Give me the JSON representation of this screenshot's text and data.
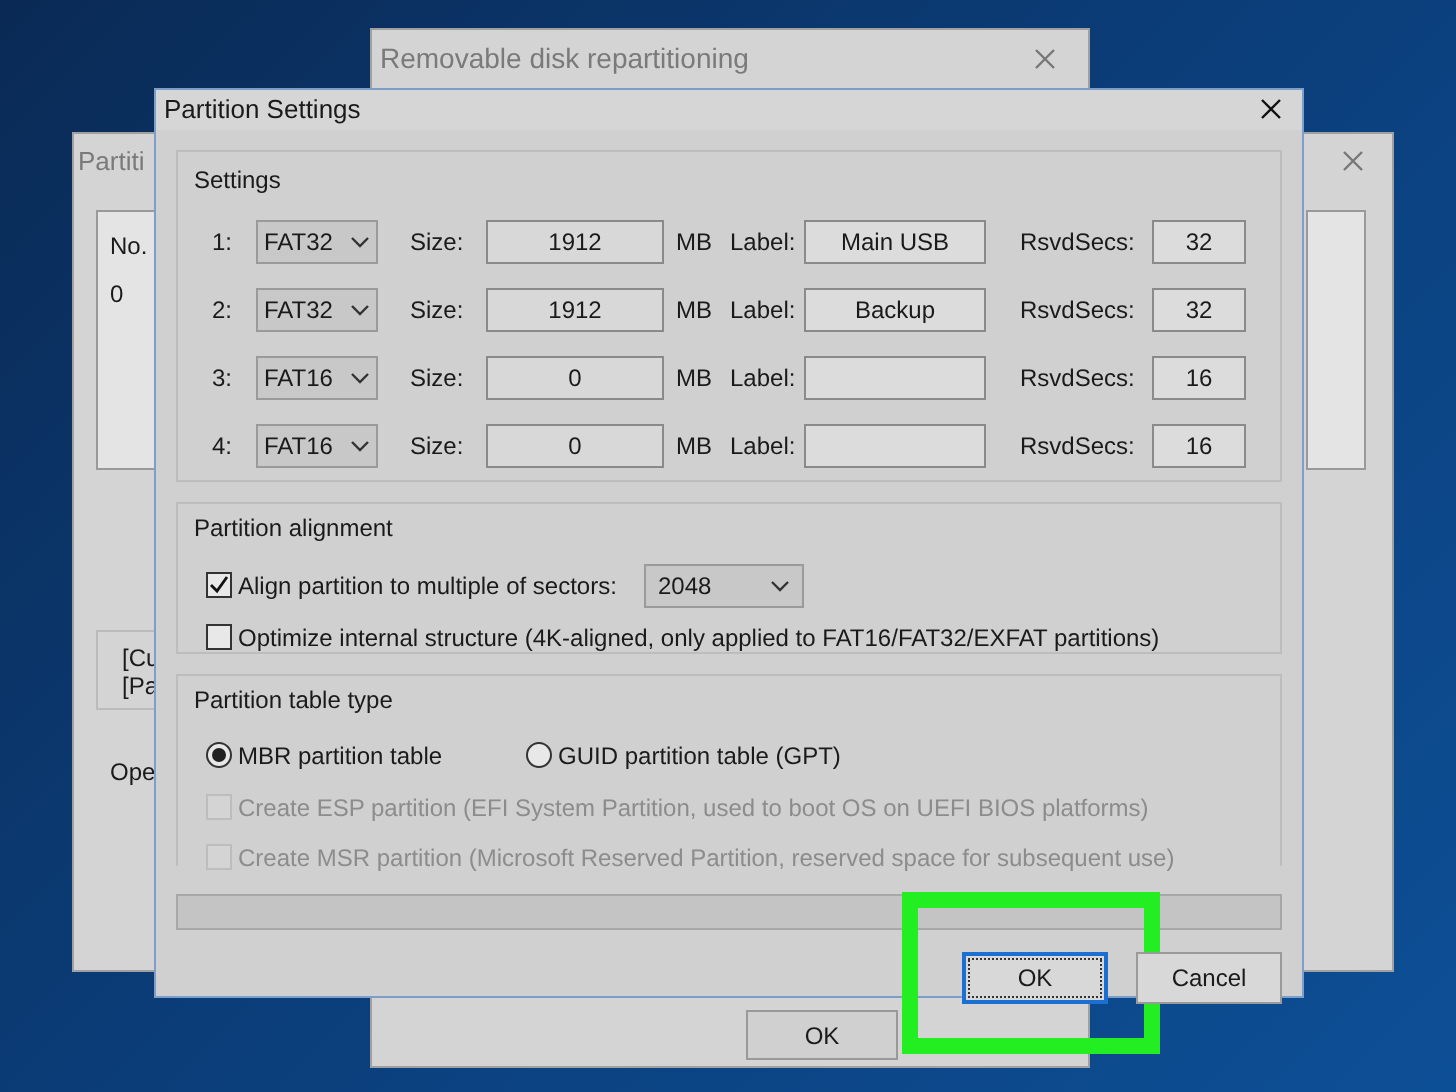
{
  "background_windows": {
    "back": {
      "title": "Removable disk repartitioning",
      "button": "OK"
    },
    "left": {
      "title": "Partiti",
      "column": "No.",
      "cell": "0",
      "lines": [
        "[Cu",
        "[Pa"
      ],
      "group": "Ope"
    }
  },
  "dialog": {
    "title": "Partition Settings",
    "settings": {
      "title": "Settings",
      "rows": [
        {
          "number": "1:",
          "type": "FAT32",
          "size_label": "Size:",
          "size": "1912",
          "unit": "MB",
          "label_label": "Label:",
          "label": "Main USB",
          "rsvd_label": "RsvdSecs:",
          "rsvd": "32"
        },
        {
          "number": "2:",
          "type": "FAT32",
          "size_label": "Size:",
          "size": "1912",
          "unit": "MB",
          "label_label": "Label:",
          "label": "Backup",
          "rsvd_label": "RsvdSecs:",
          "rsvd": "32"
        },
        {
          "number": "3:",
          "type": "FAT16",
          "size_label": "Size:",
          "size": "0",
          "unit": "MB",
          "label_label": "Label:",
          "rsvd_label": "RsvdSecs:",
          "rsvd": "16"
        },
        {
          "number": "4:",
          "type": "FAT16",
          "size_label": "Size:",
          "size": "0",
          "unit": "MB",
          "label_label": "Label:",
          "rsvd_label": "RsvdSecs:",
          "rsvd": "16"
        }
      ]
    },
    "alignment": {
      "title": "Partition alignment",
      "options": [
        {
          "kind": "checkbox-select",
          "label": "Align partition to multiple of sectors:",
          "checked": true,
          "value": "2048"
        },
        {
          "kind": "checkbox",
          "label": "Optimize internal structure (4K-aligned, only applied to FAT16/FAT32/EXFAT partitions)",
          "checked": false
        }
      ]
    },
    "table_type": {
      "title": "Partition table type",
      "radios": [
        {
          "label": "MBR partition table",
          "selected": true
        },
        {
          "label": "GUID partition table (GPT)",
          "selected": false
        }
      ],
      "checkboxes": [
        {
          "label": "Create ESP partition (EFI System Partition, used to boot OS on UEFI BIOS platforms)",
          "checked": false,
          "disabled": true
        },
        {
          "label": "Create MSR partition (Microsoft Reserved Partition, reserved space for subsequent use)",
          "checked": false,
          "disabled": true
        }
      ]
    },
    "progress": {
      "level": 0
    },
    "buttons": [
      {
        "label": "OK",
        "default": true,
        "highlighted": true
      },
      {
        "label": "Cancel",
        "default": false,
        "highlighted": false
      }
    ]
  }
}
